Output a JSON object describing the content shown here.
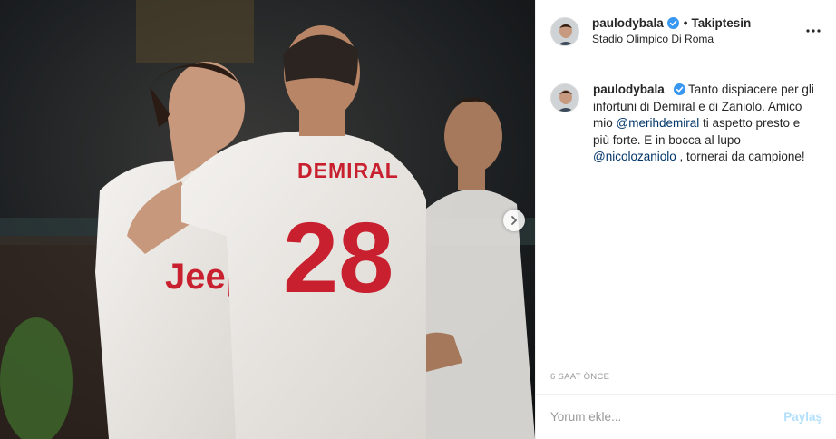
{
  "post": {
    "username": "paulodybala",
    "follow_separator": "•",
    "follow_status": "Takiptesin",
    "location": "Stadio Olimpico Di Roma",
    "caption_parts": [
      "Tanto dispiacere per gli infortuni di Demiral e di Zaniolo. Amico mio ",
      "@merihdemiral",
      " ti aspetto presto e più forte. E in bocca al lupo ",
      "@nicolozaniolo",
      " , tornerai da campione!"
    ],
    "timestamp": "6 SAAT ÖNCE"
  },
  "photo": {
    "jersey_name": "DEMIRAL",
    "jersey_number": "28",
    "sponsor": "Jeep"
  },
  "comment": {
    "placeholder": "Yorum ekle...",
    "submit_label": "Paylaş"
  },
  "icons": {
    "verified": "verified-badge-icon",
    "more": "more-options-icon",
    "carousel": "chevron-right-icon"
  },
  "colors": {
    "verified": "#3897f0",
    "mention": "#003569",
    "share_disabled": "#b2dffc",
    "jersey_red": "#c8202e"
  }
}
